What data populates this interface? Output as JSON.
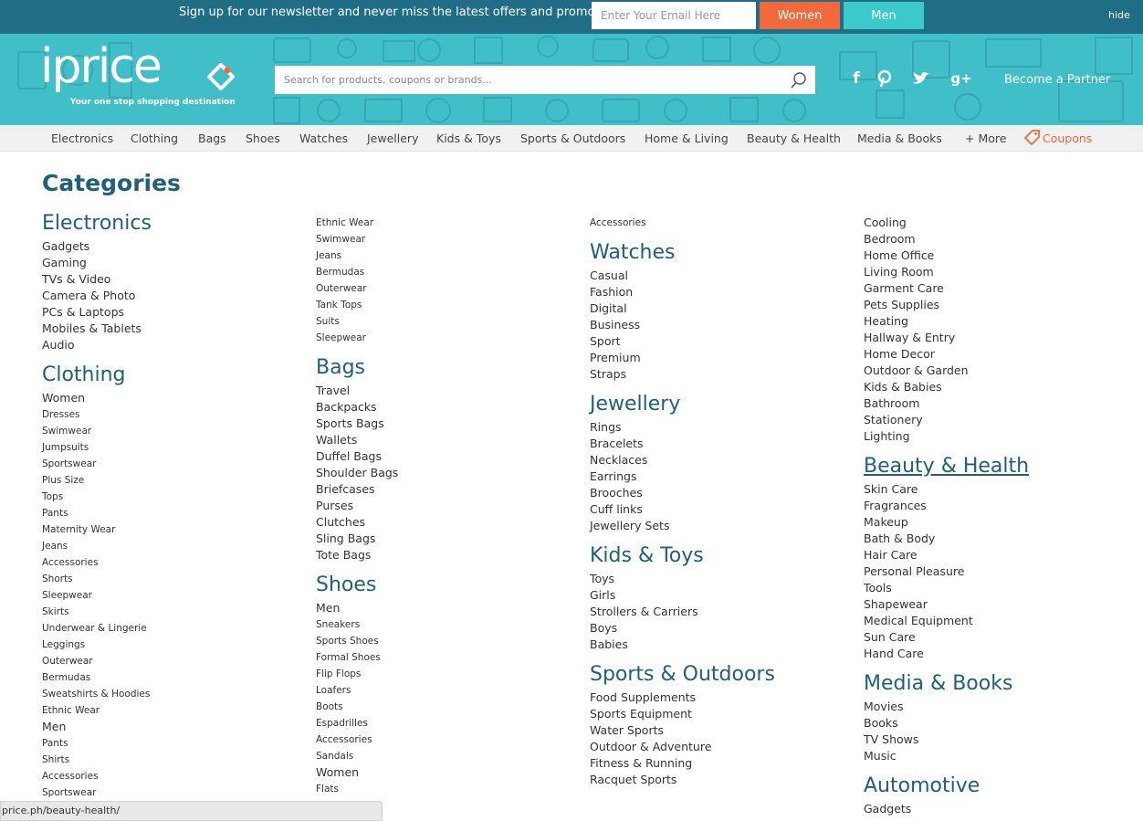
{
  "newsletter": {
    "text": "Sign up for our newsletter and never miss the latest offers and promotions:",
    "email_placeholder": "Enter Your Email Here",
    "women_label": "Women",
    "men_label": "Men",
    "hide_label": "hide"
  },
  "header": {
    "logo_text": "iprice",
    "tagline": "Your one stop shopping destination",
    "search_placeholder": "Search for products, coupons or brands...",
    "partner_label": "Become a Partner",
    "social_icons": [
      "facebook-icon",
      "pinterest-icon",
      "twitter-icon",
      "google-plus-icon"
    ],
    "colors": {
      "top_bar": "#1f6e86",
      "header": "#41bfc8",
      "accent_orange": "#f26a3c",
      "accent_teal": "#3cc9cc",
      "heading": "#1e6179"
    }
  },
  "nav": {
    "items": [
      "Electronics",
      "Clothing",
      "Bags",
      "Shoes",
      "Watches",
      "Jewellery",
      "Kids & Toys",
      "Sports & Outdoors",
      "Home & Living",
      "Beauty & Health",
      "Media & Books",
      "+ More"
    ],
    "coupons_label": "Coupons"
  },
  "page_title": "Categories",
  "columns": [
    {
      "entries": [
        {
          "type": "head",
          "text": "Electronics"
        },
        {
          "type": "sub",
          "text": "Gadgets"
        },
        {
          "type": "sub",
          "text": "Gaming"
        },
        {
          "type": "sub",
          "text": "TVs & Video"
        },
        {
          "type": "sub",
          "text": "Camera & Photo"
        },
        {
          "type": "sub",
          "text": "PCs & Laptops"
        },
        {
          "type": "sub",
          "text": "Mobiles & Tablets"
        },
        {
          "type": "sub",
          "text": "Audio"
        },
        {
          "type": "head",
          "text": "Clothing"
        },
        {
          "type": "sub",
          "text": "Women"
        },
        {
          "type": "small",
          "text": "Dresses"
        },
        {
          "type": "small",
          "text": "Swimwear"
        },
        {
          "type": "small",
          "text": "Jumpsuits"
        },
        {
          "type": "small",
          "text": "Sportswear"
        },
        {
          "type": "small",
          "text": "Plus Size"
        },
        {
          "type": "small",
          "text": "Tops"
        },
        {
          "type": "small",
          "text": "Pants"
        },
        {
          "type": "small",
          "text": "Maternity Wear"
        },
        {
          "type": "small",
          "text": "Jeans"
        },
        {
          "type": "small",
          "text": "Accessories"
        },
        {
          "type": "small",
          "text": "Shorts"
        },
        {
          "type": "small",
          "text": "Sleepwear"
        },
        {
          "type": "small",
          "text": "Skirts"
        },
        {
          "type": "small",
          "text": "Underwear & Lingerie"
        },
        {
          "type": "small",
          "text": "Leggings"
        },
        {
          "type": "small",
          "text": "Outerwear"
        },
        {
          "type": "small",
          "text": "Bermudas"
        },
        {
          "type": "small",
          "text": "Sweatshirts & Hoodies"
        },
        {
          "type": "small",
          "text": "Ethnic Wear"
        },
        {
          "type": "sub",
          "text": "Men"
        },
        {
          "type": "small",
          "text": "Pants"
        },
        {
          "type": "small",
          "text": "Shirts"
        },
        {
          "type": "small",
          "text": "Accessories"
        },
        {
          "type": "small",
          "text": "Sportswear"
        }
      ]
    },
    {
      "entries": [
        {
          "type": "small",
          "text": "Ethnic Wear"
        },
        {
          "type": "small",
          "text": "Swimwear"
        },
        {
          "type": "small",
          "text": "Jeans"
        },
        {
          "type": "small",
          "text": "Bermudas"
        },
        {
          "type": "small",
          "text": "Outerwear"
        },
        {
          "type": "small",
          "text": "Tank Tops"
        },
        {
          "type": "small",
          "text": "Suits"
        },
        {
          "type": "small",
          "text": "Sleepwear"
        },
        {
          "type": "head",
          "text": "Bags"
        },
        {
          "type": "sub",
          "text": "Travel"
        },
        {
          "type": "sub",
          "text": "Backpacks"
        },
        {
          "type": "sub",
          "text": "Sports Bags"
        },
        {
          "type": "sub",
          "text": "Wallets"
        },
        {
          "type": "sub",
          "text": "Duffel Bags"
        },
        {
          "type": "sub",
          "text": "Shoulder Bags"
        },
        {
          "type": "sub",
          "text": "Briefcases"
        },
        {
          "type": "sub",
          "text": "Purses"
        },
        {
          "type": "sub",
          "text": "Clutches"
        },
        {
          "type": "sub",
          "text": "Sling Bags"
        },
        {
          "type": "sub",
          "text": "Tote Bags"
        },
        {
          "type": "head",
          "text": "Shoes"
        },
        {
          "type": "sub",
          "text": "Men"
        },
        {
          "type": "small",
          "text": "Sneakers"
        },
        {
          "type": "small",
          "text": "Sports Shoes"
        },
        {
          "type": "small",
          "text": "Formal Shoes"
        },
        {
          "type": "small",
          "text": "Flip Flops"
        },
        {
          "type": "small",
          "text": "Loafers"
        },
        {
          "type": "small",
          "text": "Boots"
        },
        {
          "type": "small",
          "text": "Espadrilles"
        },
        {
          "type": "small",
          "text": "Accessories"
        },
        {
          "type": "small",
          "text": "Sandals"
        },
        {
          "type": "sub",
          "text": "Women"
        },
        {
          "type": "small",
          "text": "Flats"
        }
      ]
    },
    {
      "entries": [
        {
          "type": "small",
          "text": "Accessories"
        },
        {
          "type": "head",
          "text": "Watches"
        },
        {
          "type": "sub",
          "text": "Casual"
        },
        {
          "type": "sub",
          "text": "Fashion"
        },
        {
          "type": "sub",
          "text": "Digital"
        },
        {
          "type": "sub",
          "text": "Business"
        },
        {
          "type": "sub",
          "text": "Sport"
        },
        {
          "type": "sub",
          "text": "Premium"
        },
        {
          "type": "sub",
          "text": "Straps"
        },
        {
          "type": "head",
          "text": "Jewellery"
        },
        {
          "type": "sub",
          "text": "Rings"
        },
        {
          "type": "sub",
          "text": "Bracelets"
        },
        {
          "type": "sub",
          "text": "Necklaces"
        },
        {
          "type": "sub",
          "text": "Earrings"
        },
        {
          "type": "sub",
          "text": "Brooches"
        },
        {
          "type": "sub",
          "text": "Cuff links"
        },
        {
          "type": "sub",
          "text": "Jewellery Sets"
        },
        {
          "type": "head",
          "text": "Kids & Toys"
        },
        {
          "type": "sub",
          "text": "Toys"
        },
        {
          "type": "sub",
          "text": "Girls"
        },
        {
          "type": "sub",
          "text": "Strollers & Carriers"
        },
        {
          "type": "sub",
          "text": "Boys"
        },
        {
          "type": "sub",
          "text": "Babies"
        },
        {
          "type": "head",
          "text": "Sports & Outdoors"
        },
        {
          "type": "sub",
          "text": "Food Supplements"
        },
        {
          "type": "sub",
          "text": "Sports Equipment"
        },
        {
          "type": "sub",
          "text": "Water Sports"
        },
        {
          "type": "sub",
          "text": "Outdoor & Adventure"
        },
        {
          "type": "sub",
          "text": "Fitness & Running"
        },
        {
          "type": "sub",
          "text": "Racquet Sports"
        }
      ]
    },
    {
      "entries": [
        {
          "type": "sub",
          "text": "Cooling"
        },
        {
          "type": "sub",
          "text": "Bedroom"
        },
        {
          "type": "sub",
          "text": "Home Office"
        },
        {
          "type": "sub",
          "text": "Living Room"
        },
        {
          "type": "sub",
          "text": "Garment Care"
        },
        {
          "type": "sub",
          "text": "Pets Supplies"
        },
        {
          "type": "sub",
          "text": "Heating"
        },
        {
          "type": "sub",
          "text": "Hallway & Entry"
        },
        {
          "type": "sub",
          "text": "Home Decor"
        },
        {
          "type": "sub",
          "text": "Outdoor & Garden"
        },
        {
          "type": "sub",
          "text": "Kids & Babies"
        },
        {
          "type": "sub",
          "text": "Bathroom"
        },
        {
          "type": "sub",
          "text": "Stationery"
        },
        {
          "type": "sub",
          "text": "Lighting"
        },
        {
          "type": "head",
          "text": "Beauty & Health",
          "hover": true
        },
        {
          "type": "sub",
          "text": "Skin Care"
        },
        {
          "type": "sub",
          "text": "Fragrances"
        },
        {
          "type": "sub",
          "text": "Makeup"
        },
        {
          "type": "sub",
          "text": "Bath & Body"
        },
        {
          "type": "sub",
          "text": "Hair Care"
        },
        {
          "type": "sub",
          "text": "Personal Pleasure"
        },
        {
          "type": "sub",
          "text": "Tools"
        },
        {
          "type": "sub",
          "text": "Shapewear"
        },
        {
          "type": "sub",
          "text": "Medical Equipment"
        },
        {
          "type": "sub",
          "text": "Sun Care"
        },
        {
          "type": "sub",
          "text": "Hand Care"
        },
        {
          "type": "head",
          "text": "Media & Books"
        },
        {
          "type": "sub",
          "text": "Movies"
        },
        {
          "type": "sub",
          "text": "Books"
        },
        {
          "type": "sub",
          "text": "TV Shows"
        },
        {
          "type": "sub",
          "text": "Music"
        },
        {
          "type": "head",
          "text": "Automotive"
        },
        {
          "type": "sub",
          "text": "Gadgets"
        }
      ]
    }
  ],
  "status_bar": "price.ph/beauty-health/"
}
